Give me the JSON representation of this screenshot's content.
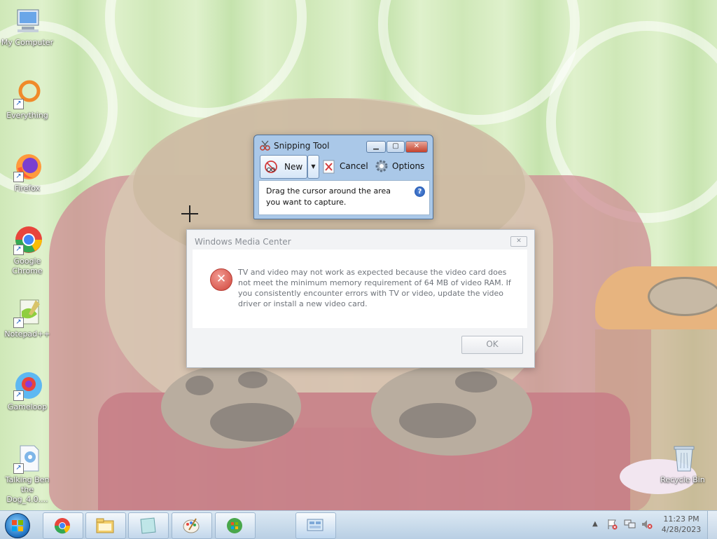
{
  "desktop": {
    "icons": [
      {
        "label": "My Computer",
        "icon": "computer-icon"
      },
      {
        "label": "Everything",
        "icon": "everything-search-icon"
      },
      {
        "label": "Firefox",
        "icon": "firefox-icon"
      },
      {
        "label": "Google\nChrome",
        "icon": "chrome-icon"
      },
      {
        "label": "Notepad++",
        "icon": "notepadpp-icon"
      },
      {
        "label": "Gameloop",
        "icon": "gameloop-icon"
      },
      {
        "label": "Talking Ben\nthe Dog_4.0....",
        "icon": "installer-icon"
      },
      {
        "label": "Recycle Bin",
        "icon": "recycle-bin-icon"
      }
    ]
  },
  "snipping_tool": {
    "title": "Snipping Tool",
    "new_label": "New",
    "cancel_label": "Cancel",
    "options_label": "Options",
    "instruction": "Drag the cursor around the area you want to capture.",
    "help_glyph": "?"
  },
  "wmc_dialog": {
    "title": "Windows Media Center",
    "message": "TV and video may not work as expected because the video card does not meet the minimum memory requirement of 64 MB of video RAM. If you consistently encounter errors with TV or video, update the video driver or install a new video card.",
    "ok_label": "OK"
  },
  "taskbar": {
    "pinned": [
      "chrome-icon",
      "file-explorer-icon",
      "notes-icon",
      "paint-icon",
      "windows-media-center-icon",
      "snipping-tool-icon"
    ],
    "clock_time": "11:23 PM",
    "clock_date": "4/28/2023"
  },
  "colors": {
    "taskbar": "#c9dbeb",
    "snip_frame": "#aac8e8",
    "error_red": "#d0453b",
    "close_red": "#c4412c"
  }
}
